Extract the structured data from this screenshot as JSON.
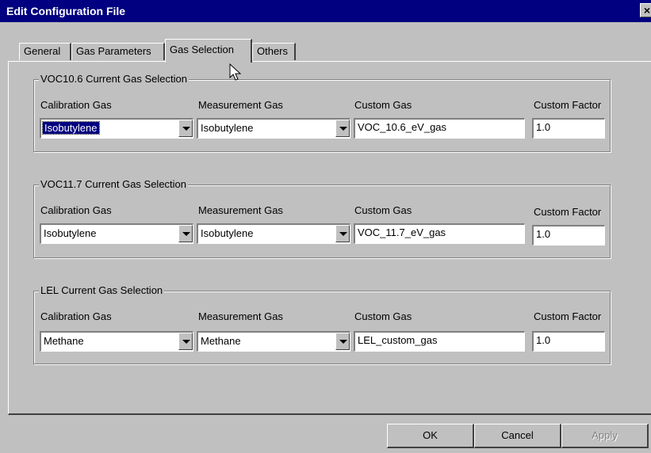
{
  "window": {
    "title": "Edit Configuration File",
    "close_label": "×"
  },
  "tabs": [
    {
      "label": "General"
    },
    {
      "label": "Gas Parameters"
    },
    {
      "label": "Gas Selection"
    },
    {
      "label": "Others"
    }
  ],
  "active_tab": "Gas Selection",
  "columns": {
    "calibration": "Calibration Gas",
    "measurement": "Measurement Gas",
    "custom_gas": "Custom Gas",
    "custom_factor": "Custom Factor"
  },
  "groups": [
    {
      "title": "VOC10.6 Current Gas Selection",
      "calibration_gas": "Isobutylene",
      "measurement_gas": "Isobutylene",
      "custom_gas": "VOC_10.6_eV_gas",
      "custom_factor": "1.0"
    },
    {
      "title": "VOC11.7 Current Gas Selection",
      "calibration_gas": "Isobutylene",
      "measurement_gas": "Isobutylene",
      "custom_gas": "VOC_11.7_eV_gas",
      "custom_factor": "1.0"
    },
    {
      "title": "LEL Current Gas Selection",
      "calibration_gas": "Methane",
      "measurement_gas": "Methane",
      "custom_gas": "LEL_custom_gas",
      "custom_factor": "1.0"
    }
  ],
  "buttons": {
    "ok": "OK",
    "cancel": "Cancel",
    "apply": "Apply"
  }
}
